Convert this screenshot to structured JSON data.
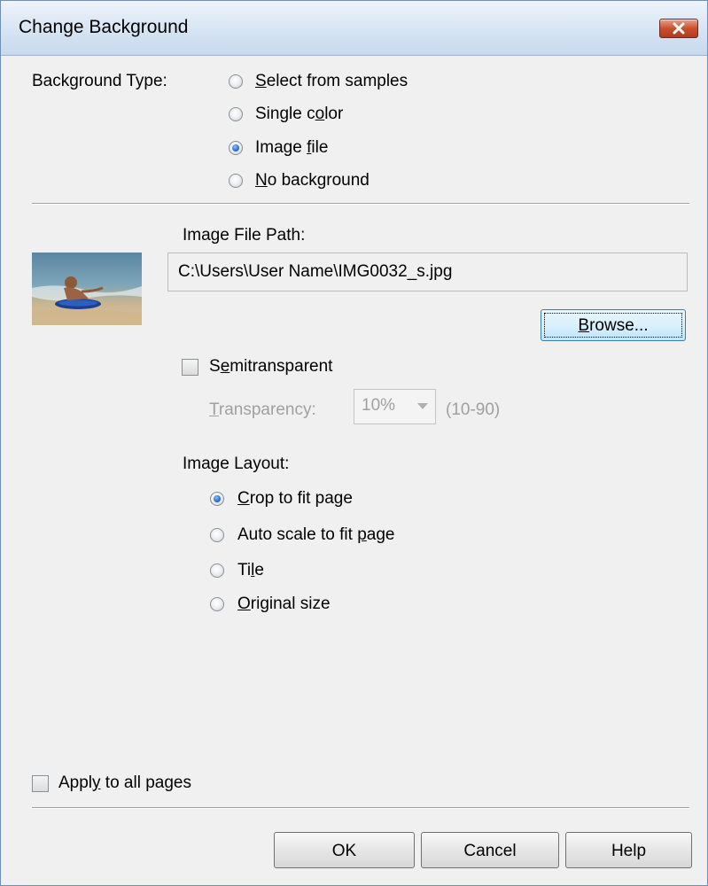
{
  "window": {
    "title": "Change Background"
  },
  "background_type": {
    "label": "Background Type:",
    "options": [
      {
        "pre": "",
        "key": "S",
        "post": "elect from samples",
        "selected": false
      },
      {
        "pre": "Single c",
        "key": "o",
        "post": "lor",
        "selected": false
      },
      {
        "pre": "Image ",
        "key": "f",
        "post": "ile",
        "selected": true
      },
      {
        "pre": "",
        "key": "N",
        "post": "o background",
        "selected": false
      }
    ]
  },
  "image_file": {
    "path_label": "Image File Path:",
    "path_value": "C:\\Users\\User Name\\IMG0032_s.jpg",
    "browse": {
      "key": "B",
      "post": "rowse..."
    }
  },
  "semitransparent": {
    "checked": false,
    "pre": "S",
    "key": "e",
    "post": "mitransparent",
    "transparency_key": "T",
    "transparency_post": "ransparency:",
    "value": "10%",
    "range": "(10-90)"
  },
  "image_layout": {
    "label": "Image Layout:",
    "options": [
      {
        "pre": "",
        "key": "C",
        "post": "rop to fit page",
        "selected": true
      },
      {
        "pre": "Auto scale to fit ",
        "key": "p",
        "post": "age",
        "selected": false
      },
      {
        "pre": "Ti",
        "key": "l",
        "post": "e",
        "selected": false
      },
      {
        "pre": "",
        "key": "O",
        "post": "riginal size",
        "selected": false
      }
    ]
  },
  "apply_all": {
    "pre": "Appl",
    "key": "y",
    "post": " to all pages",
    "checked": false
  },
  "buttons": {
    "ok": "OK",
    "cancel": "Cancel",
    "help": "Help"
  },
  "colors": {
    "title_bar": "#d6e4f3",
    "dialog_bg": "#f0f0f0",
    "radio_selected": "#2f6fd6",
    "close_button": "#c7512f"
  }
}
